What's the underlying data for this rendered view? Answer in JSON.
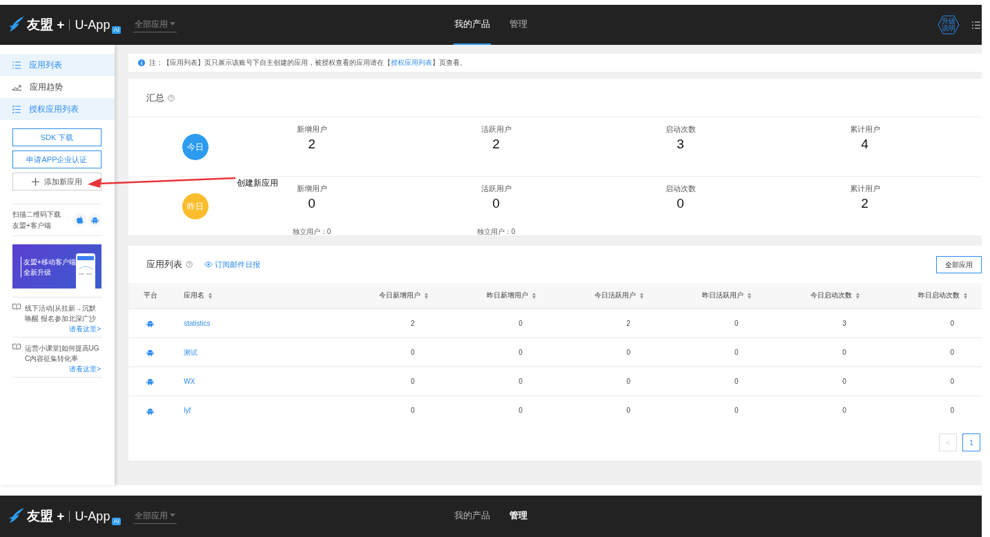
{
  "header": {
    "logo": "友盟 +",
    "product": "U-App",
    "badge": "AI",
    "app_select": "全部应用",
    "upgrade": [
      "升级",
      "说明"
    ],
    "nav": [
      {
        "label": "我的产品",
        "selected": true
      },
      {
        "label": "管理",
        "selected": false
      }
    ]
  },
  "sidebar": {
    "menu": [
      {
        "label": "应用列表",
        "selected": true,
        "kind": "list"
      },
      {
        "label": "应用趋势",
        "selected": false,
        "kind": "trend"
      },
      {
        "label": "授权应用列表",
        "selected": true,
        "kind": "checklist"
      }
    ],
    "buttons": [
      "SDK 下载",
      "申请APP企业认证"
    ],
    "add_button": "添加新应用",
    "qr_text": [
      "扫描二维码下载",
      "友盟+客户端"
    ],
    "banner": [
      "友盟+移动客户端",
      "全新升级"
    ],
    "news": [
      {
        "text": "线下活动|从拉新→沉默唤醒 报名参加北深广沙",
        "link": "请看这里>"
      },
      {
        "text": "运营小课堂|如何提高UGC内容征集转化率",
        "link": "请看这里>"
      }
    ]
  },
  "notice": {
    "before": "注：【应用列表】页只展示该账号下自主创建的应用，被授权查看的应用请在【",
    "link": "授权应用列表",
    "after": "】页查看。"
  },
  "summary": {
    "title": "汇总",
    "rows": [
      {
        "label": "今日",
        "color": "#2d9cf0",
        "stats": [
          {
            "label": "新增用户",
            "value": "2"
          },
          {
            "label": "活跃用户",
            "value": "2"
          },
          {
            "label": "启动次数",
            "value": "3"
          },
          {
            "label": "累计用户",
            "value": "4"
          }
        ]
      },
      {
        "label": "昨日",
        "color": "#fbbd2d",
        "stats": [
          {
            "label": "新增用户",
            "value": "0",
            "sub": "独立用户：0"
          },
          {
            "label": "活跃用户",
            "value": "0",
            "sub": "独立用户：0"
          },
          {
            "label": "启动次数",
            "value": "0"
          },
          {
            "label": "累计用户",
            "value": "2"
          }
        ]
      }
    ]
  },
  "app_list": {
    "title": "应用列表",
    "subscribe": "订阅邮件日报",
    "filter": "全部应用",
    "columns": [
      {
        "label": "平台",
        "sortable": false
      },
      {
        "label": "应用名",
        "sortable": true
      },
      {
        "label": "今日新增用户",
        "sortable": true
      },
      {
        "label": "昨日新增用户",
        "sortable": true
      },
      {
        "label": "今日活跃用户",
        "sortable": true
      },
      {
        "label": "昨日活跃用户",
        "sortable": true
      },
      {
        "label": "今日启动次数",
        "sortable": true
      },
      {
        "label": "昨日启动次数",
        "sortable": true
      }
    ],
    "rows": [
      {
        "name": "statistics",
        "values": [
          "2",
          "0",
          "2",
          "0",
          "3",
          "0"
        ]
      },
      {
        "name": "测试",
        "values": [
          "0",
          "0",
          "0",
          "0",
          "0",
          "0"
        ]
      },
      {
        "name": "WX",
        "values": [
          "0",
          "0",
          "0",
          "0",
          "0",
          "0"
        ]
      },
      {
        "name": "lyf",
        "values": [
          "0",
          "0",
          "0",
          "0",
          "0",
          "0"
        ]
      }
    ],
    "pagination": {
      "prev": "<",
      "prev_disabled": true,
      "pages": [
        {
          "label": "1",
          "selected": true
        }
      ]
    }
  },
  "annotation": {
    "text": "创建新应用"
  },
  "header_repeat": {
    "logo": "友盟 +",
    "product": "U-App",
    "badge": "AI",
    "app_select": "全部应用",
    "nav": [
      {
        "label": "我的产品",
        "selected": false
      },
      {
        "label": "管理",
        "selected": true
      }
    ]
  }
}
